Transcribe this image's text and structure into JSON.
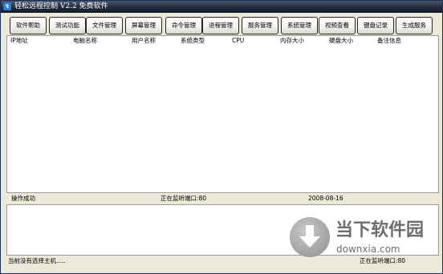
{
  "window": {
    "title": "轻松远程控制 V2.2  免费软件",
    "icon": "app-logo-icon"
  },
  "toolbar": {
    "buttons": [
      {
        "label": "软件帮助"
      },
      {
        "label": "测试功能"
      },
      {
        "label": "文件管理"
      },
      {
        "label": "屏幕管理"
      },
      {
        "label": "命令管理"
      },
      {
        "label": "进程管理"
      },
      {
        "label": "服务管理"
      },
      {
        "label": "系统管理"
      },
      {
        "label": "视频查看"
      },
      {
        "label": "键盘记录"
      },
      {
        "label": "生成服务"
      }
    ]
  },
  "host_list": {
    "columns": [
      "IP地址",
      "电脑名称",
      "用户名称",
      "系统类型",
      "CPU",
      "内存大小",
      "硬盘大小",
      "备注信息"
    ],
    "rows": []
  },
  "status": {
    "message": "操作成功",
    "listening": "正在监听端口:80",
    "date": "2008-08-16"
  },
  "statusbar": {
    "left": "当前没有选择主机.....",
    "right": "正在监听端口:80"
  },
  "watermark": {
    "brand": "当下软件园",
    "url": "downxia.com"
  }
}
